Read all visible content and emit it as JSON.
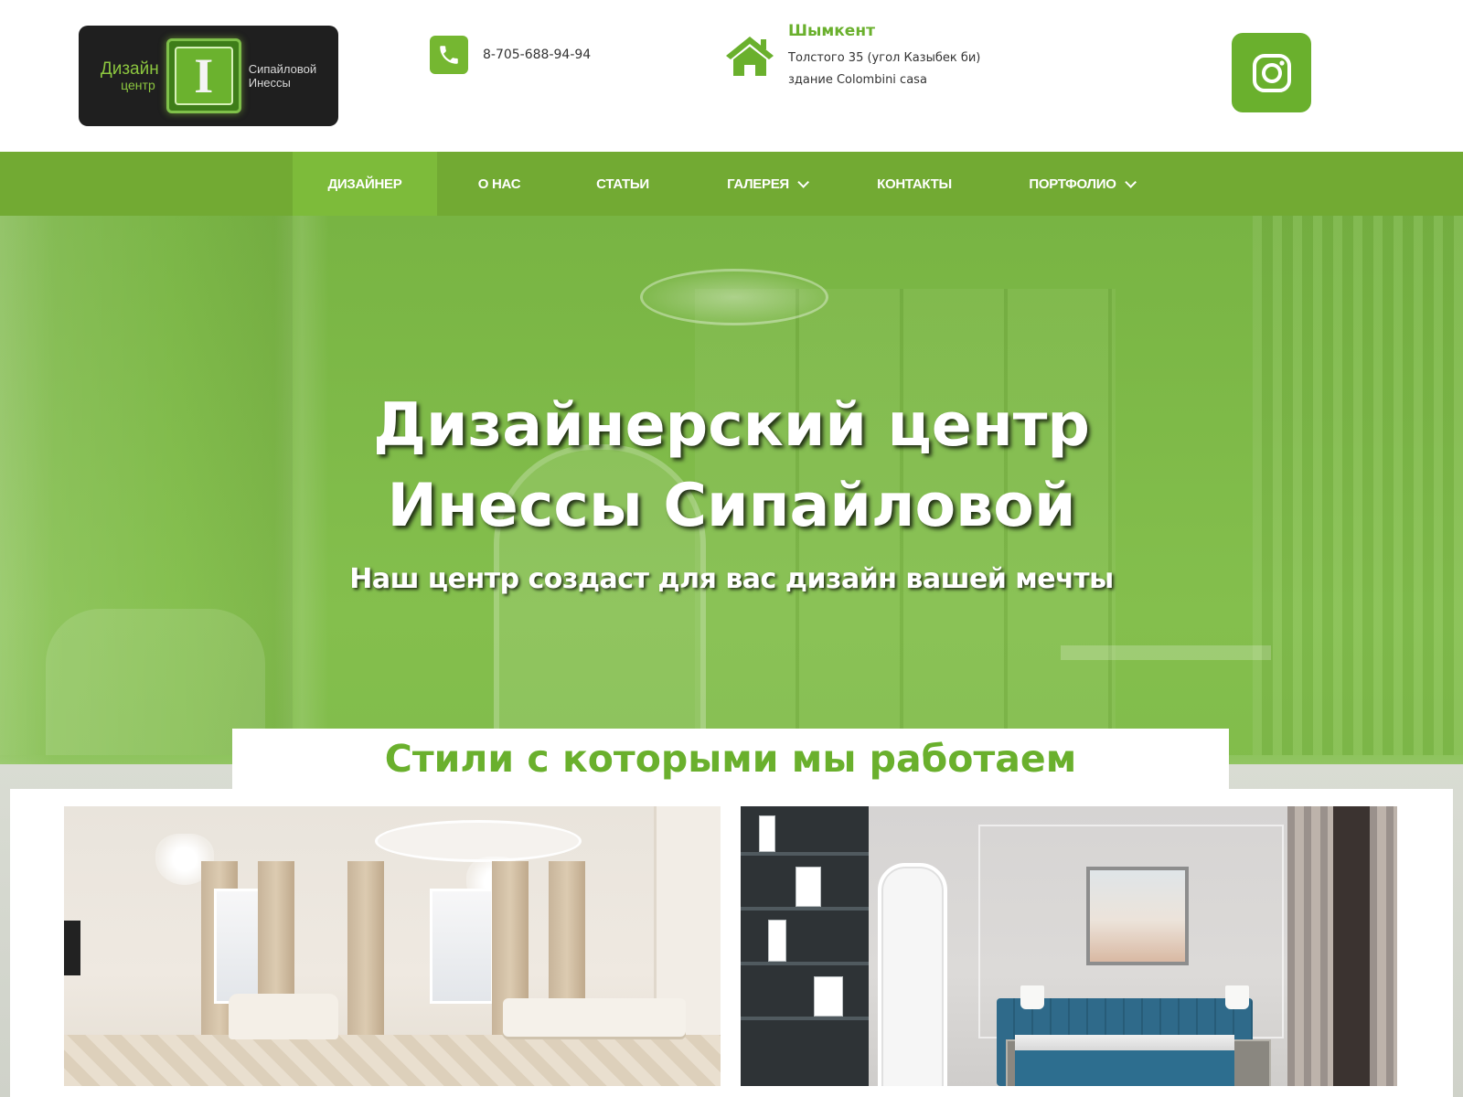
{
  "brand": {
    "logo_line1": "Дизайн",
    "logo_line2": "центр",
    "logo_letter": "I",
    "logo_name1": "Сипайловой",
    "logo_name2": "Инессы"
  },
  "contact": {
    "phone": "8-705-688-94-94",
    "city": "Шымкент",
    "address_line1": "Толстого 35 (угол Казыбек би)",
    "address_line2": "здание Colombini casa"
  },
  "icons": {
    "phone": "phone-icon",
    "home": "home-icon",
    "instagram": "instagram-icon",
    "dropdown": "chevron-down-icon"
  },
  "nav": {
    "items": [
      {
        "label": "ДИЗАЙНЕР",
        "active": true,
        "dropdown": false
      },
      {
        "label": "О НАС",
        "active": false,
        "dropdown": false
      },
      {
        "label": "СТАТЬИ",
        "active": false,
        "dropdown": false
      },
      {
        "label": "ГАЛЕРЕЯ",
        "active": false,
        "dropdown": true
      },
      {
        "label": "КОНТАКТЫ",
        "active": false,
        "dropdown": false
      },
      {
        "label": "ПОРТФОЛИО",
        "active": false,
        "dropdown": true
      }
    ]
  },
  "hero": {
    "title_line1": "Дизайнерский центр",
    "title_line2": "Инессы Сипайловой",
    "subtitle": "Наш центр создаст для вас дизайн вашей мечты"
  },
  "styles_section": {
    "title": "Стили с которыми мы работаем"
  },
  "colors": {
    "accent": "#6ab02d",
    "nav_bg": "#72aa33",
    "nav_active": "#7dbb3a",
    "logo_bg": "#1f1f1f"
  }
}
